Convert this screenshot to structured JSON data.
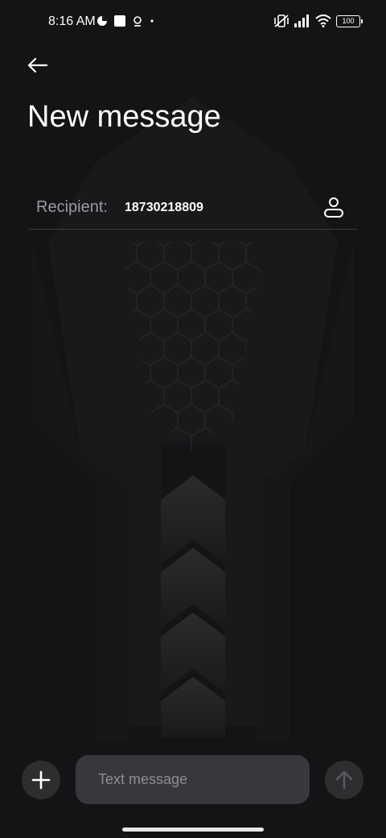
{
  "status_bar": {
    "time": "8:16 AM",
    "left_icons": [
      "data-saver-icon",
      "square-notification-icon",
      "location-pin-icon",
      "dot-icon"
    ],
    "right_icons": [
      "vibrate-off-icon",
      "signal-icon",
      "wifi-icon",
      "battery-icon"
    ],
    "battery_level": "100"
  },
  "header": {
    "back_icon": "arrow-left-icon",
    "title": "New message"
  },
  "recipient": {
    "label": "Recipient:",
    "value": "18730218809",
    "contact_icon": "person-icon"
  },
  "composer": {
    "add_icon": "plus-icon",
    "placeholder": "Text message",
    "send_icon": "arrow-up-icon"
  },
  "colors": {
    "background": "#141416",
    "input_bg": "#38383c",
    "button_bg": "#2e2e31",
    "placeholder": "#8d8d92",
    "label": "#9a9a9f"
  }
}
